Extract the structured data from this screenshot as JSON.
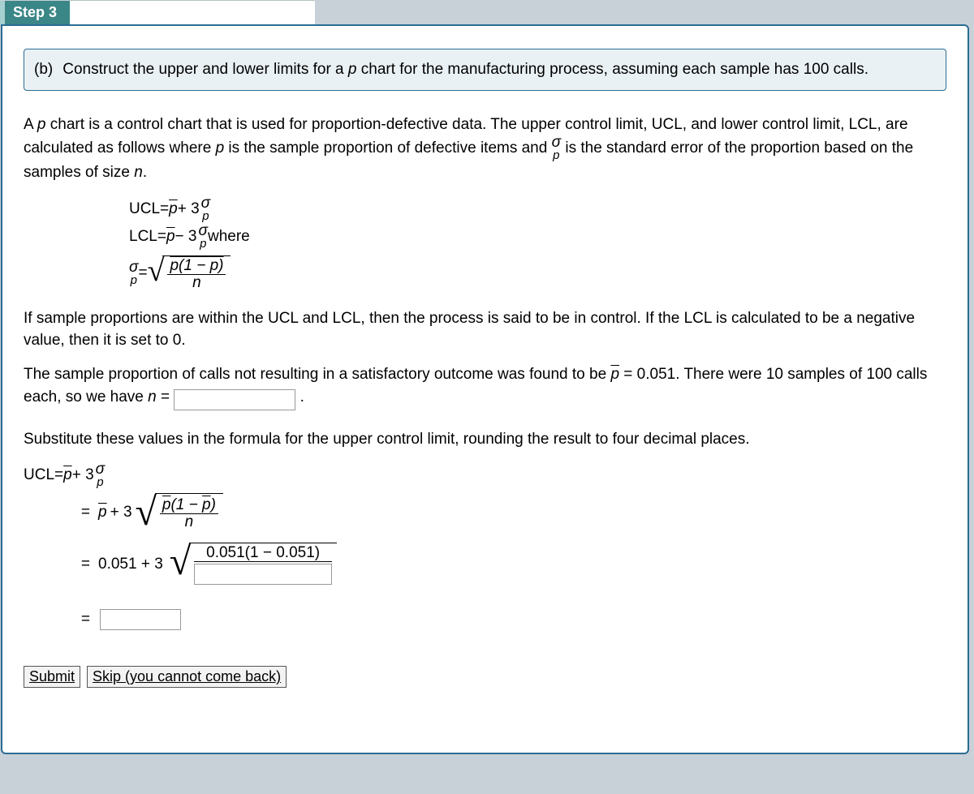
{
  "step": {
    "label": "Step 3"
  },
  "question": {
    "label": "(b)",
    "text_1": "Construct the upper and lower limits for a ",
    "text_p": "p",
    "text_2": " chart for the manufacturing process, assuming each sample has 100 calls."
  },
  "intro": {
    "t1": "A ",
    "p1": "p",
    "t2": " chart is a control chart that is used for proportion-defective data. The upper control limit, UCL, and lower control limit, LCL, are calculated as follows where ",
    "p2": "p",
    "t3": " is the sample proportion of defective items and ",
    "sigma": "σ",
    "pbar": "p",
    "t4": " is the standard error of the proportion based on the samples of size ",
    "nvar": "n",
    "t5": "."
  },
  "formulas": {
    "ucl_lhs": "UCL",
    "lcl_lhs": "LCL",
    "eq": " = ",
    "p": "p",
    "plus3": " + 3",
    "minus3": " − 3",
    "sigma": "σ",
    "pbar": "p",
    "where": " where",
    "sigma_eq": " = ",
    "frac_num": "p(1 − p)",
    "frac_den": "n"
  },
  "para2": {
    "text": "If sample proportions are within the UCL and LCL, then the process is said to be in control. If the LCL is calculated to be a negative value, then it is set to 0."
  },
  "para3": {
    "t1": "The sample proportion of calls not resulting in a satisfactory outcome was found to be ",
    "pvar": "p",
    "t2": " = 0.051. There were 10 samples of 100 calls each, so we have ",
    "nvar": "n",
    "t3": " = ",
    "period": "."
  },
  "para4": {
    "text": "Substitute these values in the formula for the upper control limit, rounding the result to four decimal places."
  },
  "calc": {
    "line1_lhs": "UCL",
    "line1_rhs_a": " = ",
    "p": "p",
    "plus3": " + 3",
    "sigma": "σ",
    "pbar": "p",
    "line2_a": "p",
    "line2_b": " + 3",
    "frac_num": "p(1 − p)",
    "frac_den": "n",
    "line3_a": "0.051 + 3",
    "line3_num": "0.051(1 − 0.051)"
  },
  "buttons": {
    "submit": "Submit",
    "skip": "Skip (you cannot come back)"
  }
}
